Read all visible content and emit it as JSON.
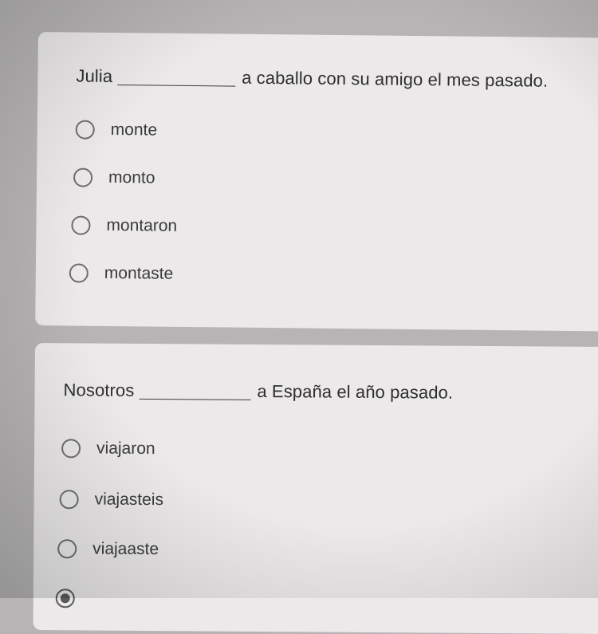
{
  "questions": [
    {
      "subject": "Julia",
      "predicate": "a caballo con su amigo el mes pasado.",
      "options": [
        {
          "label": "monte",
          "selected": false
        },
        {
          "label": "monto",
          "selected": false
        },
        {
          "label": "montaron",
          "selected": false
        },
        {
          "label": "montaste",
          "selected": false
        }
      ]
    },
    {
      "subject": "Nosotros",
      "predicate": "a España el año pasado.",
      "options": [
        {
          "label": "viajaron",
          "selected": false
        },
        {
          "label": "viajasteis",
          "selected": false
        },
        {
          "label": "viajaaste",
          "selected": false
        },
        {
          "label": "",
          "selected": true
        }
      ]
    }
  ]
}
